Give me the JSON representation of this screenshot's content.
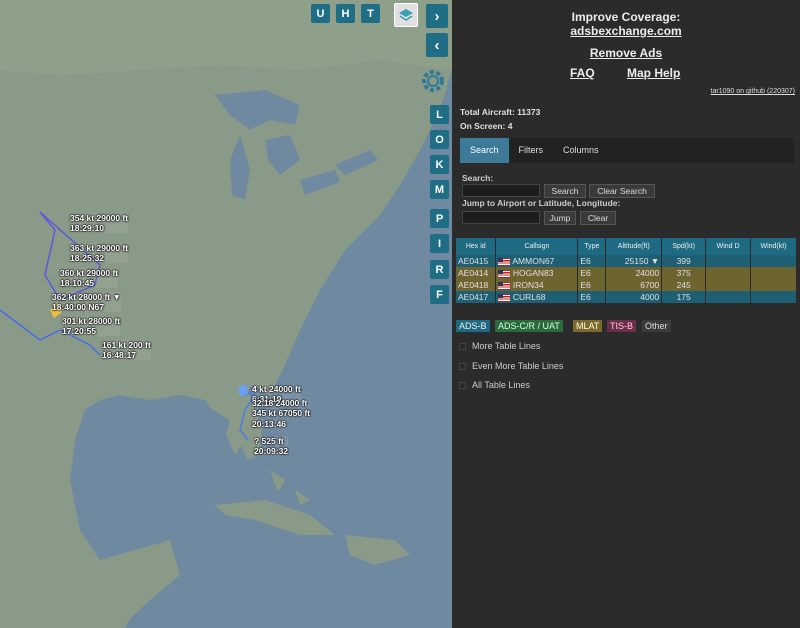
{
  "map": {
    "layer_buttons": [
      "U",
      "H",
      "T"
    ],
    "side_buttons": [
      "L",
      "O",
      "K",
      "M",
      "P",
      "I",
      "R",
      "F"
    ],
    "aircraft_labels": [
      {
        "id": "a1",
        "line1": "354 kt  29000 ft",
        "line2": "18:29:10"
      },
      {
        "id": "a2",
        "line1": "363 kt  29000 ft",
        "line2": "18:25:32"
      },
      {
        "id": "a3",
        "line1": "360 kt  29000 ft",
        "line2": "18:10:45"
      },
      {
        "id": "a4",
        "line1": "362 kt  28000 ft ▼",
        "line2": "18:40:00 N67"
      },
      {
        "id": "a5",
        "line1": "301 kt  28000 ft",
        "line2": "17:20:55"
      },
      {
        "id": "a6",
        "line1": "161 kt  200 ft",
        "line2": "16:48:17"
      },
      {
        "id": "a7",
        "line1": "4 kt  24000 ft",
        "line2": "6:31:19"
      },
      {
        "id": "a8",
        "line1": "32.18  24000 ft",
        "line2": "345 kt 67050 ft"
      },
      {
        "id": "a9",
        "line1": "20:13:46",
        "line2": ""
      },
      {
        "id": "a10",
        "line1": "?  525 ft",
        "line2": "20:09:32"
      }
    ]
  },
  "panel": {
    "improve_line1": "Improve Coverage:",
    "improve_line2": "adsbexchange.com",
    "remove_ads": "Remove Ads",
    "faq": "FAQ",
    "map_help": "Map Help",
    "version": "tar1090 on github (220307)",
    "total_aircraft": "Total Aircraft: 11373",
    "on_screen": "On Screen: 4",
    "tabs": [
      "Search",
      "Filters",
      "Columns"
    ],
    "search_label": "Search:",
    "search_button": "Search",
    "clear_search_button": "Clear Search",
    "jump_label": "Jump to Airport or Latitude, Longitude:",
    "jump_button": "Jump",
    "clear_button": "Clear",
    "table_headers": [
      "Hex id",
      "Callsign",
      "Type",
      "Altitude(ft)",
      "Spd(kt)",
      "Wind D",
      "Wind(kt)"
    ],
    "rows": [
      {
        "hex": "AE0415",
        "callsign": "AMMON67",
        "type": "E6",
        "alt": "25150 ▼",
        "spd": "399",
        "wd": "",
        "wk": ""
      },
      {
        "hex": "AE0414",
        "callsign": "HOGAN83",
        "type": "E6",
        "alt": "24000",
        "spd": "375",
        "wd": "",
        "wk": ""
      },
      {
        "hex": "AE0418",
        "callsign": "IRON34",
        "type": "E6",
        "alt": "6700",
        "spd": "245",
        "wd": "",
        "wk": ""
      },
      {
        "hex": "AE0417",
        "callsign": "CURL68",
        "type": "E6",
        "alt": "4000",
        "spd": "175",
        "wd": "",
        "wk": ""
      }
    ],
    "legend": [
      "ADS-B",
      "ADS-C/R / UAT",
      "MLAT",
      "TIS-B",
      "Other"
    ],
    "checkboxes": [
      "More Table Lines",
      "Even More Table Lines",
      "All Table Lines"
    ]
  }
}
